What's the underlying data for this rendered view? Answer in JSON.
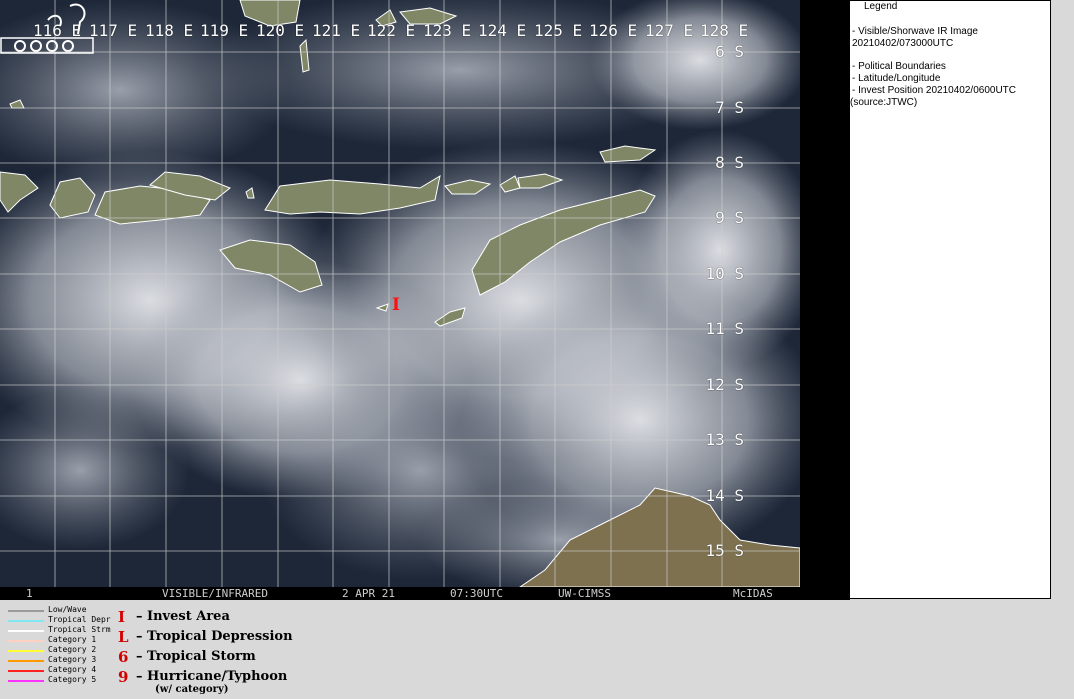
{
  "map": {
    "lon_labels": [
      "116 E",
      "117 E",
      "118 E",
      "119 E",
      "120 E",
      "121 E",
      "122 E",
      "123 E",
      "124 E",
      "125 E",
      "126 E",
      "127 E",
      "128 E"
    ],
    "lat_labels": [
      "6 S",
      "7 S",
      "8 S",
      "9 S",
      "10 S",
      "11 S",
      "12 S",
      "13 S",
      "14 S",
      "15 S"
    ],
    "invest_marker": "I",
    "colors": {
      "land": "#7c8262",
      "ocean": "#1b2536",
      "cloud": "#d8dbe0",
      "grid": "#cfcfcf",
      "coast": "#ffffff",
      "invest": "#ff1010"
    }
  },
  "bar": {
    "frame": "1",
    "product": "VISIBLE/INFRARED",
    "date": "2 APR 21",
    "time": "07:30UTC",
    "source": "UW-CIMSS",
    "software": "McIDAS"
  },
  "legend": {
    "title": "Legend",
    "line1": "-  Visible/Shorwave IR Image",
    "line2": "20210402/073000UTC",
    "line3": "-  Political Boundaries",
    "line4": "-  Latitude/Longitude",
    "line5": "-  Invest Position  20210402/0600UTC",
    "line6": "(source:JTWC)"
  },
  "track_key": [
    {
      "label": "Low/Wave",
      "color": "#9a9a9a"
    },
    {
      "label": "Tropical Depr",
      "color": "#7fe8f0"
    },
    {
      "label": "Tropical Strm",
      "color": "#ffffff"
    },
    {
      "label": "Category 1",
      "color": "#ffd0c0"
    },
    {
      "label": "Category 2",
      "color": "#ffff33"
    },
    {
      "label": "Category 3",
      "color": "#ff9900"
    },
    {
      "label": "Category 4",
      "color": "#ff2020"
    },
    {
      "label": "Category 5",
      "color": "#ff33ff"
    }
  ],
  "symbol_key": [
    {
      "symbol": "I",
      "label": "– Invest Area"
    },
    {
      "symbol": "L",
      "label": "– Tropical Depression"
    },
    {
      "symbol": "6",
      "label": "– Tropical Storm"
    },
    {
      "symbol": "9",
      "label": "– Hurricane/Typhoon"
    }
  ],
  "symbol_key_note": "(w/ category)"
}
